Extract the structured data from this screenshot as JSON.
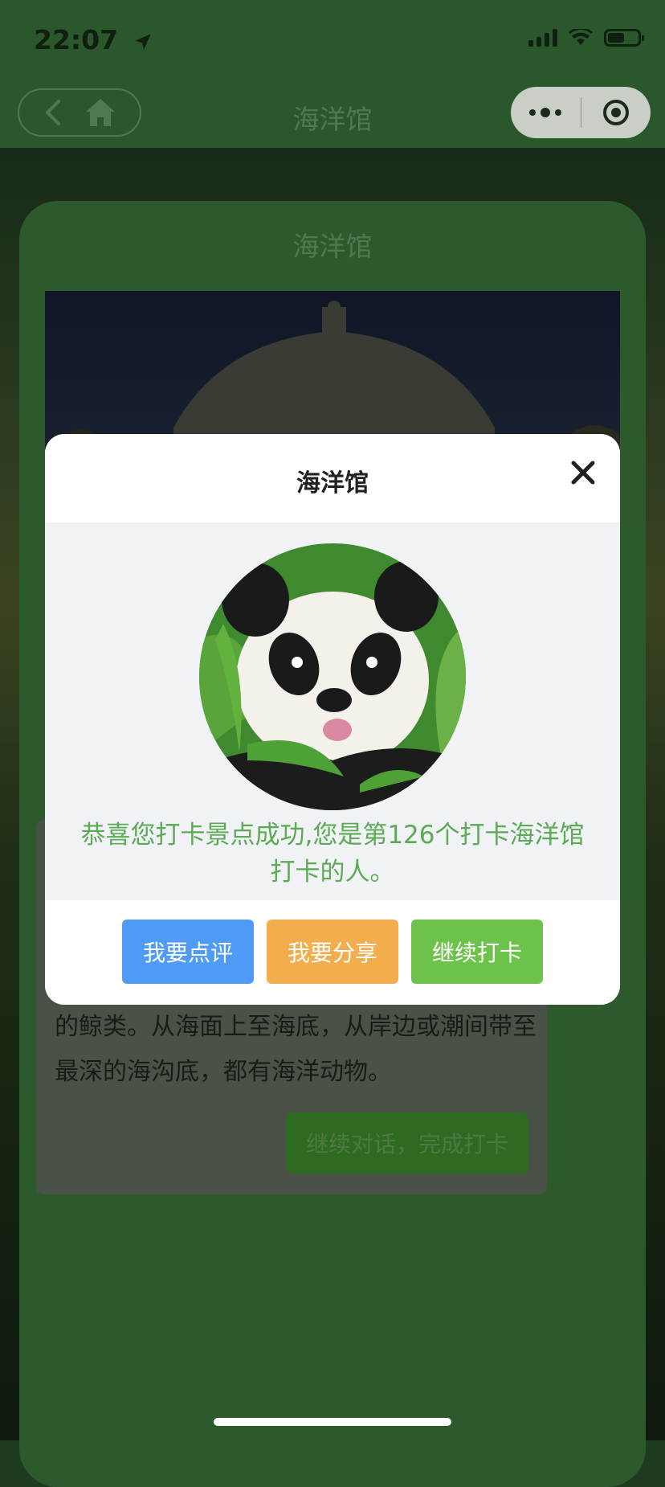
{
  "status_bar": {
    "time": "22:07"
  },
  "nav": {
    "title": "海洋馆"
  },
  "card": {
    "title": "海洋馆",
    "bubble_text": "的鲸类。从海面上至海底，从岸边或潮间带至最深的海沟底，都有海洋动物。",
    "bubble_button": "继续对话，完成打卡"
  },
  "modal": {
    "title": "海洋馆",
    "message": "恭喜您打卡景点成功,您是第126个打卡海洋馆打卡的人。",
    "buttons": {
      "review": "我要点评",
      "share": "我要分享",
      "continue": "继续打卡"
    }
  },
  "colors": {
    "review_button": "#4f9bf5",
    "share_button": "#f2ae4d",
    "continue_button": "#6cc24a",
    "message_text": "#5cab54"
  }
}
